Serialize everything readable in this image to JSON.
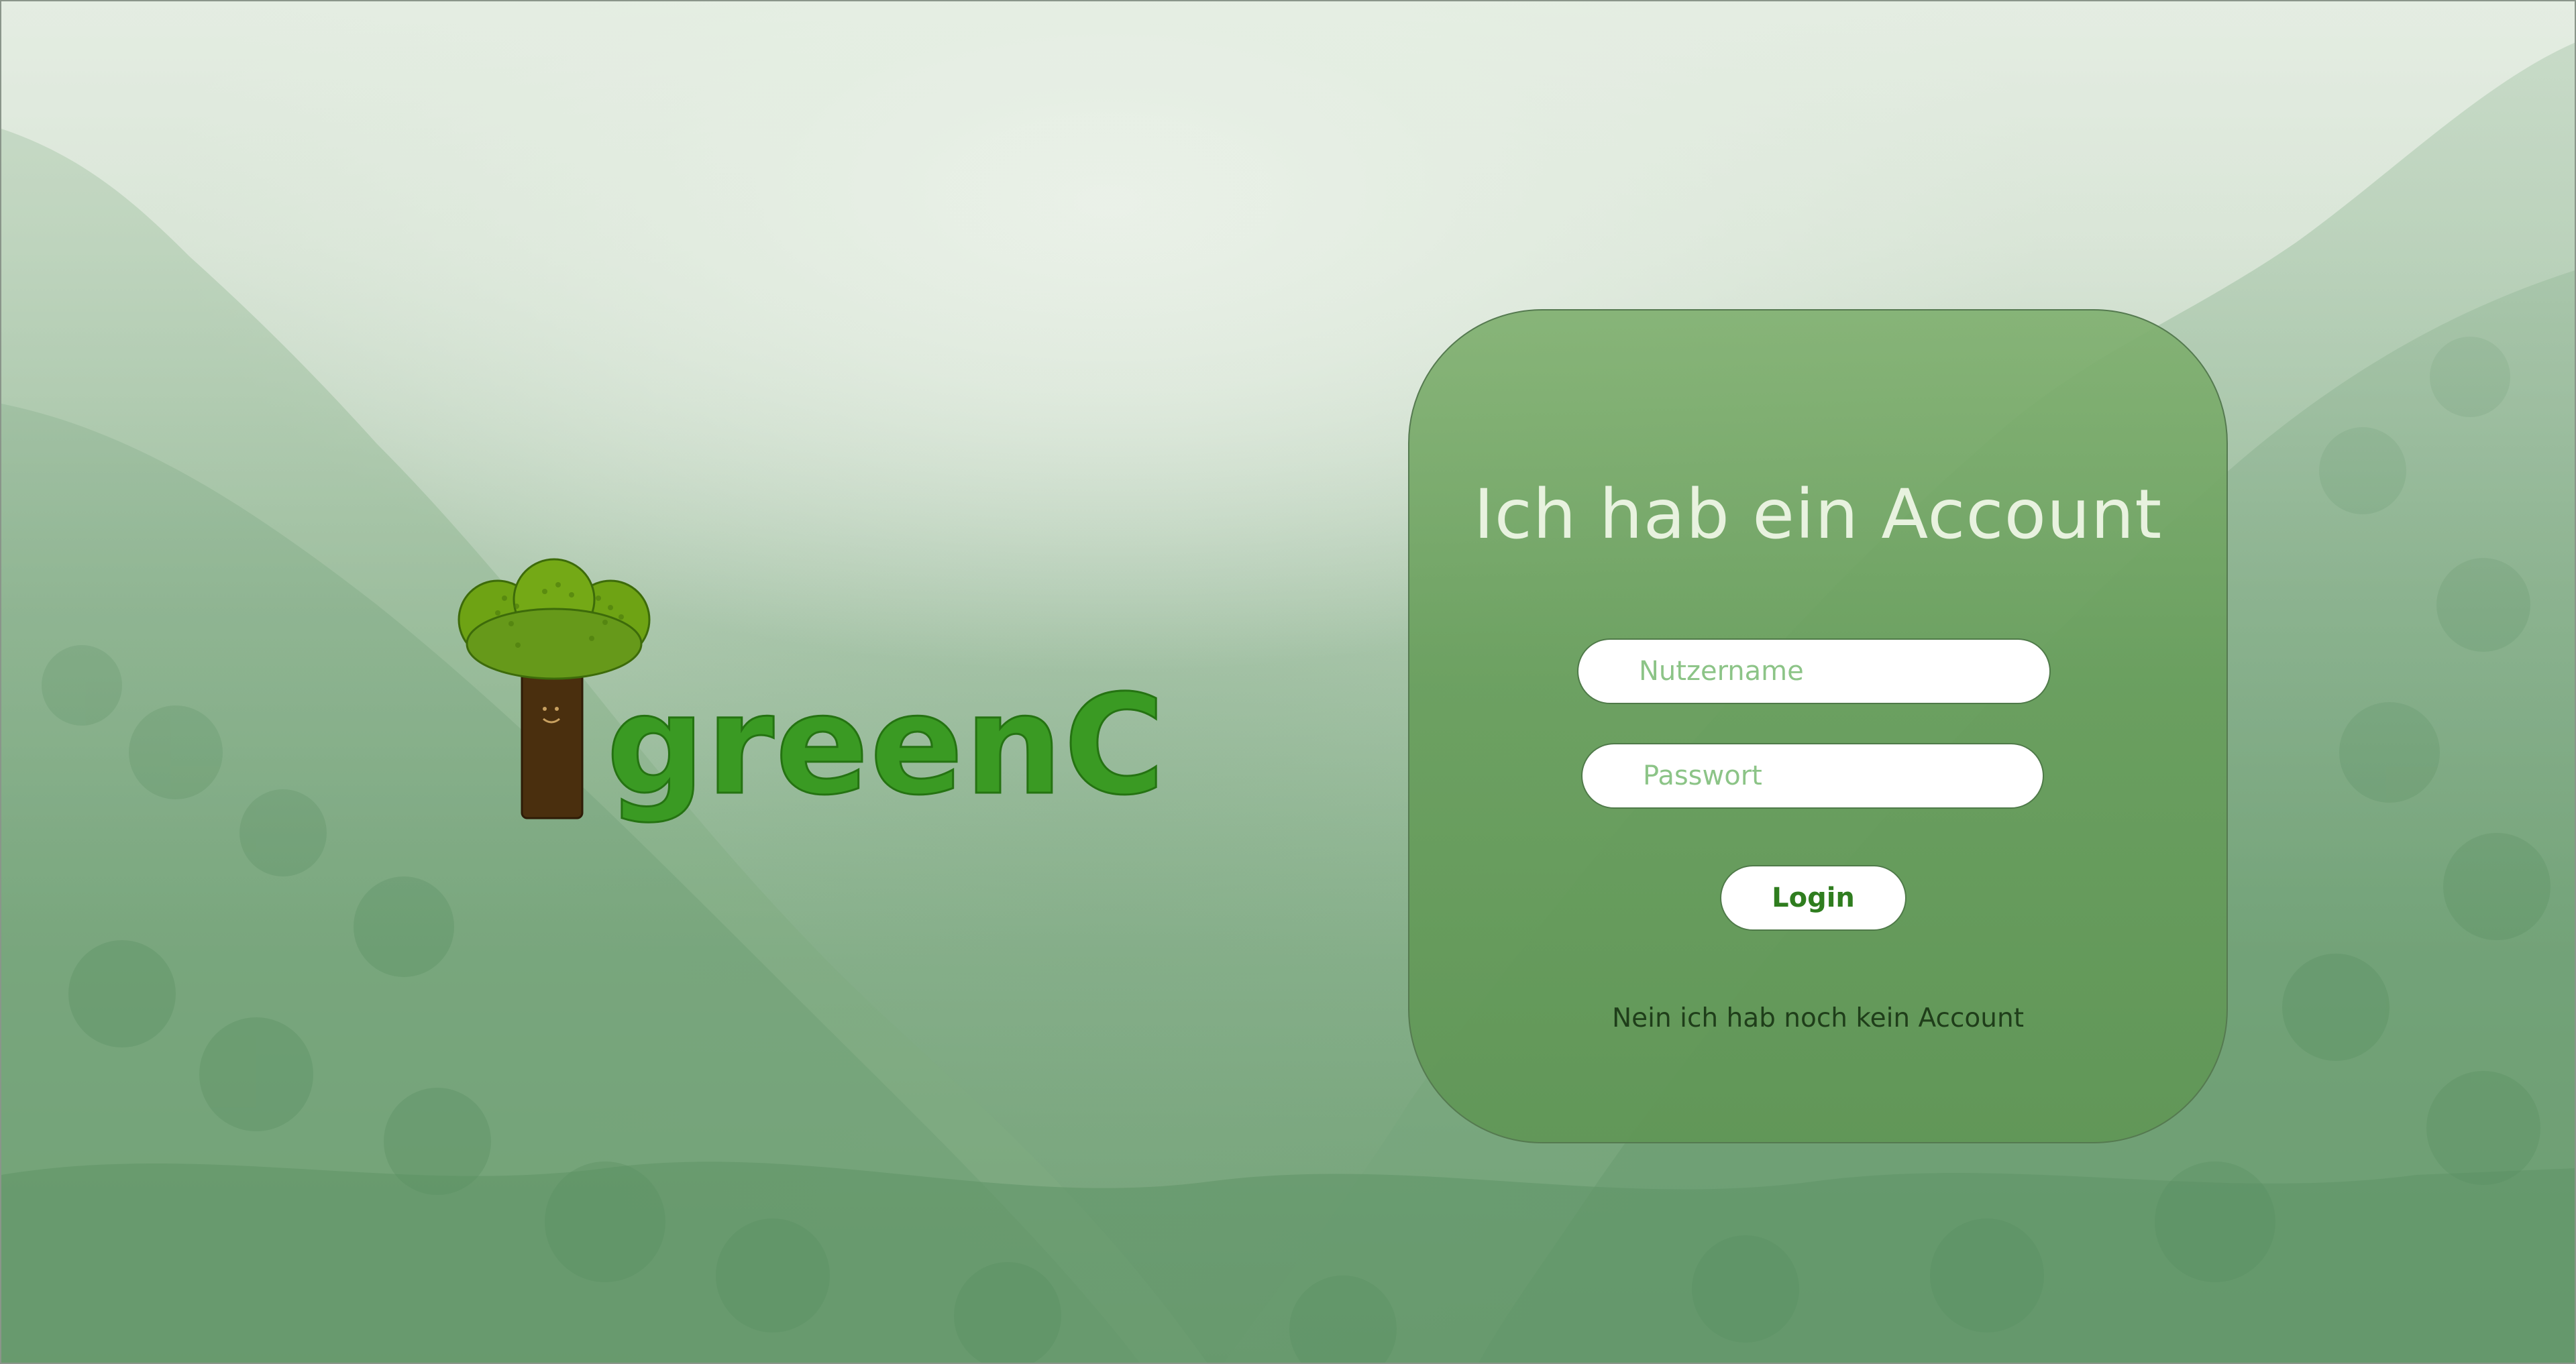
{
  "brand": {
    "name": "greenC",
    "text_color": "#3a9a23",
    "icon": "tree-mascot-icon"
  },
  "login": {
    "title": "Ich hab ein Account",
    "username_placeholder": "Nutzername",
    "username_value": "",
    "password_placeholder": "Passwort",
    "password_value": "",
    "login_label": "Login",
    "register_link": "Nein ich hab noch kein Account"
  },
  "colors": {
    "card": "#6a9f5c",
    "accent": "#2f7d1f",
    "placeholder": "#8cc487"
  }
}
